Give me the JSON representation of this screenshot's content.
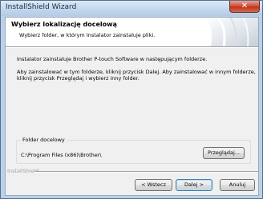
{
  "window": {
    "title": "InstallShield Wizard",
    "close_glyph": "✕"
  },
  "header": {
    "title": "Wybierz lokalizację docelową",
    "subtitle": "Wybierz folder, w którym Instalator zainstaluje pliki.",
    "art_icon": "installshield-banner-art"
  },
  "body": {
    "line1": "Instalator zainstaluje Brother P-touch Software w następującym folderze.",
    "line2": "Aby zainstalować w tym folderze, kliknij przycisk Dalej. Aby zainstalować w innym folderze,",
    "line3": "kliknij przycisk Przeglądaj i wybierz inny folder."
  },
  "destination": {
    "group_label": "Folder docelowy",
    "path": "C:\\Program Files (x86)\\Brother\\",
    "browse_label": "Przeglądaj..."
  },
  "footer": {
    "brand": "InstallShield",
    "back_label": "< Wstecz",
    "next_label": "Dalej >",
    "cancel_label": "Anuluj"
  },
  "colors": {
    "titlebar": "#c3d8ef",
    "close_button": "#c0341c",
    "dialog_background": "#f0f0f0",
    "header_background": "#ffffff",
    "default_button_border": "#3c7fb1"
  }
}
